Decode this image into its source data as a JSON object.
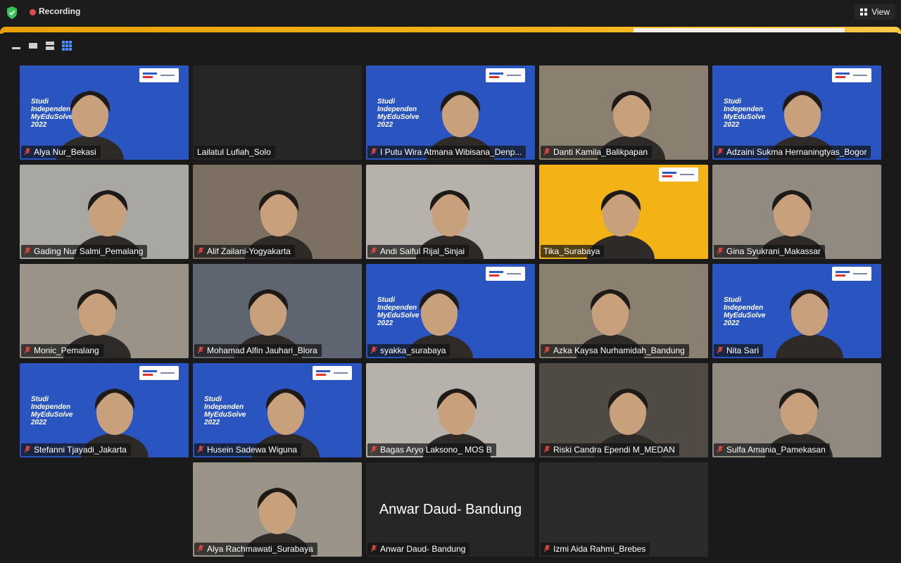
{
  "topbar": {
    "recording_label": "Recording",
    "view_label": "View",
    "colors": {
      "recording_dot": "#e24b4b",
      "shield": "#35c35a"
    }
  },
  "meeting_brand": {
    "background_text": [
      "Studi",
      "Independen",
      "MyEduSolve",
      "2022"
    ],
    "background_color": "#2a55c0"
  },
  "participants": [
    {
      "name": "Alya Nur_Bekasi",
      "muted": true,
      "video": "blue-bg"
    },
    {
      "name": "Lailatul Lufiah_Solo",
      "muted": false,
      "video": "off"
    },
    {
      "name": "I Putu Wira Atmana Wibisana_Denp...",
      "muted": true,
      "video": "blue-bg"
    },
    {
      "name": "Danti Kamila_Balikpapan",
      "muted": true,
      "video": "room"
    },
    {
      "name": "Adzaini Sukma Hernaningtyas_Bogor",
      "muted": true,
      "video": "blue-bg"
    },
    {
      "name": "Gading Nur Salmi_Pemalang",
      "muted": true,
      "video": "room"
    },
    {
      "name": "Alif Zailani-Yogyakarta",
      "muted": true,
      "video": "room"
    },
    {
      "name": "Andi Saiful Rijal_Sinjai",
      "muted": true,
      "video": "room"
    },
    {
      "name": "Tika_Surabaya",
      "muted": false,
      "video": "yellow-bg",
      "active_speaker": true
    },
    {
      "name": "Gina Syukrani_Makassar",
      "muted": true,
      "video": "room"
    },
    {
      "name": "Monic_Pemalang",
      "muted": true,
      "video": "room"
    },
    {
      "name": "Mohamad Alfin Jauhari_Blora",
      "muted": true,
      "video": "room"
    },
    {
      "name": "syakka_surabaya",
      "muted": true,
      "video": "blue-bg"
    },
    {
      "name": "Azka Kaysa Nurhamidah_Bandung",
      "muted": true,
      "video": "room"
    },
    {
      "name": "Nita Sari",
      "muted": true,
      "video": "blue-bg"
    },
    {
      "name": "Stefanni Tjayadi_Jakarta",
      "muted": true,
      "video": "blue-bg"
    },
    {
      "name": "Husein Sadewa Wiguna",
      "muted": true,
      "video": "blue-bg"
    },
    {
      "name": "Bagas Aryo Laksono_ MOS B",
      "muted": true,
      "video": "room"
    },
    {
      "name": "Riski Candra Ependi M_MEDAN",
      "muted": true,
      "video": "room"
    },
    {
      "name": "Sulfa Amania_Pamekasan",
      "muted": true,
      "video": "room"
    },
    {
      "name": "Alya Rachmawati_Surabaya",
      "muted": true,
      "video": "room"
    },
    {
      "name": "Anwar Daud- Bandung",
      "muted": true,
      "video": "off",
      "big_name": "Anwar Daud- Bandung"
    },
    {
      "name": "Izmi Aida Rahmi_Brebes",
      "muted": true,
      "video": "dark"
    }
  ]
}
